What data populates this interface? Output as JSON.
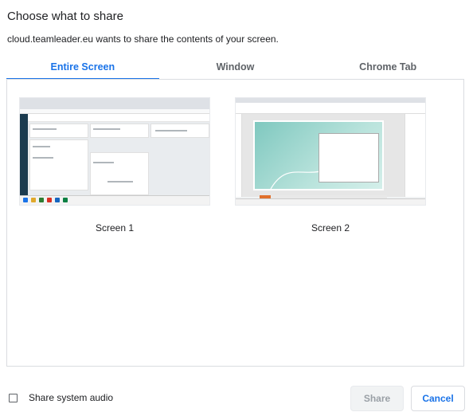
{
  "dialog": {
    "title": "Choose what to share",
    "subtitle": "cloud.teamleader.eu wants to share the contents of your screen."
  },
  "tabs": [
    {
      "label": "Entire Screen",
      "active": true
    },
    {
      "label": "Window",
      "active": false
    },
    {
      "label": "Chrome Tab",
      "active": false
    }
  ],
  "screens": [
    {
      "label": "Screen 1",
      "selected": false
    },
    {
      "label": "Screen 2",
      "selected": false
    }
  ],
  "footer": {
    "audio_label": "Share system audio",
    "audio_checked": false,
    "share_label": "Share",
    "share_enabled": false,
    "cancel_label": "Cancel"
  },
  "colors": {
    "accent": "#1a73e8",
    "text": "#202124",
    "muted": "#5f6368",
    "border": "#dadce0"
  }
}
